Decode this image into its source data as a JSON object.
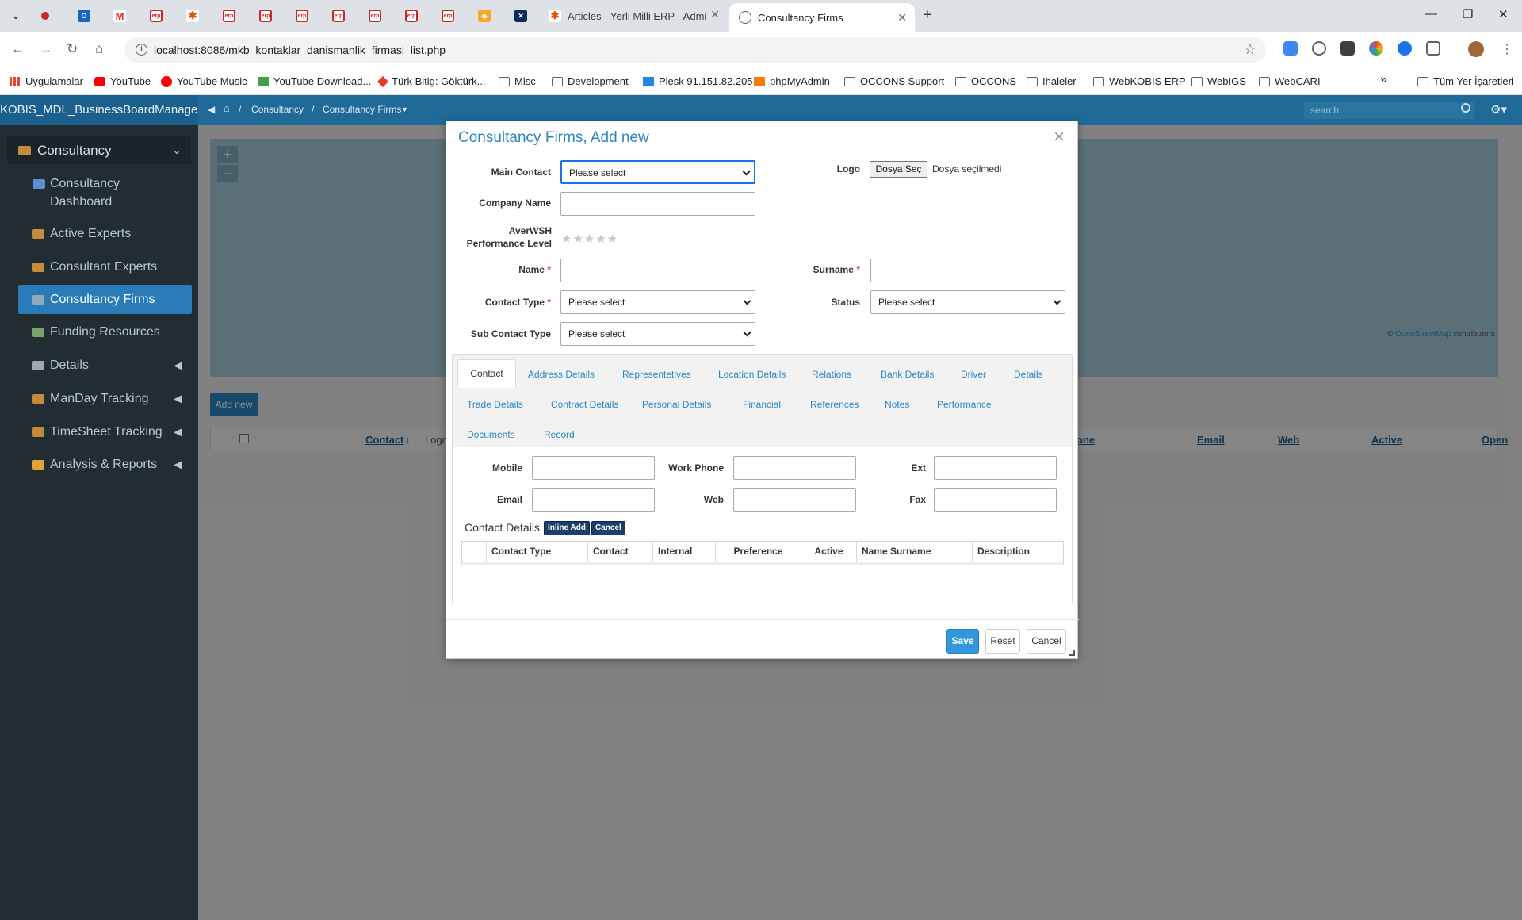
{
  "browser": {
    "tabs": [
      {
        "title": "Articles - Yerli Milli ERP - Admi"
      },
      {
        "title": "Consultancy Firms"
      }
    ],
    "url": "localhost:8086/mkb_kontaklar_danismanlik_firmasi_list.php",
    "bookmarks": [
      {
        "label": "Uygulamalar",
        "icon": "apps-icon"
      },
      {
        "label": "YouTube",
        "icon": "youtube-icon"
      },
      {
        "label": "YouTube Music",
        "icon": "youtube-music-icon"
      },
      {
        "label": "YouTube Download...",
        "icon": "download-icon"
      },
      {
        "label": "Türk Bitig: Göktürk...",
        "icon": "gokturk-icon"
      },
      {
        "label": "Misc",
        "icon": "folder-icon"
      },
      {
        "label": "Development",
        "icon": "folder-icon"
      },
      {
        "label": "Plesk 91.151.82.205",
        "icon": "plesk-icon"
      },
      {
        "label": "phpMyAdmin",
        "icon": "phpmyadmin-icon"
      },
      {
        "label": "OCCONS Support",
        "icon": "folder-icon"
      },
      {
        "label": "OCCONS",
        "icon": "folder-icon"
      },
      {
        "label": "Ihaleler",
        "icon": "folder-icon"
      },
      {
        "label": "WebKOBIS ERP",
        "icon": "folder-icon"
      },
      {
        "label": "WebIGS",
        "icon": "folder-icon"
      },
      {
        "label": "WebCARI",
        "icon": "folder-icon"
      }
    ],
    "bookmarks_more": "»",
    "all_bookmarks": "Tüm Yer İşaretleri"
  },
  "app": {
    "brand": "KOBIS_MDL_BusinessBoardManager",
    "breadcrumb": [
      "Consultancy",
      "Consultancy Firms"
    ],
    "search_placeholder": "search",
    "sidebar": {
      "header": "Consultancy",
      "items": [
        {
          "label": "Consultancy Dashboard"
        },
        {
          "label": "Active Experts"
        },
        {
          "label": "Consultant Experts"
        },
        {
          "label": "Consultancy Firms",
          "active": true
        },
        {
          "label": "Funding Resources"
        },
        {
          "label": "Details",
          "expandable": true
        },
        {
          "label": "ManDay Tracking",
          "expandable": true
        },
        {
          "label": "TimeSheet Tracking",
          "expandable": true
        },
        {
          "label": "Analysis & Reports",
          "expandable": true
        }
      ]
    },
    "map": {
      "zoom_in": "+",
      "zoom_out": "−",
      "credit_link": "OpenStreetMap",
      "credit_suffix": "contributors",
      "credit_prefix": "©"
    },
    "add_new": "Add new",
    "grid_columns": [
      "Contact",
      "Logo",
      "one",
      "Email",
      "Web",
      "Active",
      "Open"
    ]
  },
  "modal": {
    "title": "Consultancy Firms, Add new",
    "close": "×",
    "fields": {
      "main_contact": {
        "label": "Main Contact",
        "value": "Please select"
      },
      "logo": {
        "label": "Logo",
        "button": "Dosya Seç",
        "status": "Dosya seçilmedi"
      },
      "company_name": {
        "label": "Company Name",
        "value": ""
      },
      "performance": {
        "label_line1": "AverWSH",
        "label_line2": "Performance Level",
        "stars": "★★★★★"
      },
      "name": {
        "label": "Name",
        "required": "*",
        "value": ""
      },
      "surname": {
        "label": "Surname",
        "required": "*",
        "value": ""
      },
      "contact_type": {
        "label": "Contact Type",
        "required": "*",
        "value": "Please select"
      },
      "status": {
        "label": "Status",
        "value": "Please select"
      },
      "sub_contact_type": {
        "label": "Sub Contact Type",
        "value": "Please select"
      }
    },
    "tabs": [
      [
        "Contact",
        "Address Details",
        "Representetives",
        "Location Details",
        "Relations",
        "Bank Details",
        "Driver",
        "Details"
      ],
      [
        "Trade Details",
        "Contract Details",
        "Personal Details",
        "Financial",
        "References",
        "Notes",
        "Performance"
      ],
      [
        "Documents",
        "Record"
      ]
    ],
    "contact_tab": {
      "mobile": "Mobile",
      "work_phone": "Work Phone",
      "ext": "Ext",
      "email": "Email",
      "web": "Web",
      "fax": "Fax",
      "details_title": "Contact Details",
      "inline_add": "Inline Add",
      "cancel": "Cancel",
      "columns": [
        "Contact Type",
        "Contact",
        "Internal",
        "Preference",
        "Active",
        "Name Surname",
        "Description"
      ]
    },
    "buttons": {
      "save": "Save",
      "reset": "Reset",
      "cancel": "Cancel"
    }
  }
}
